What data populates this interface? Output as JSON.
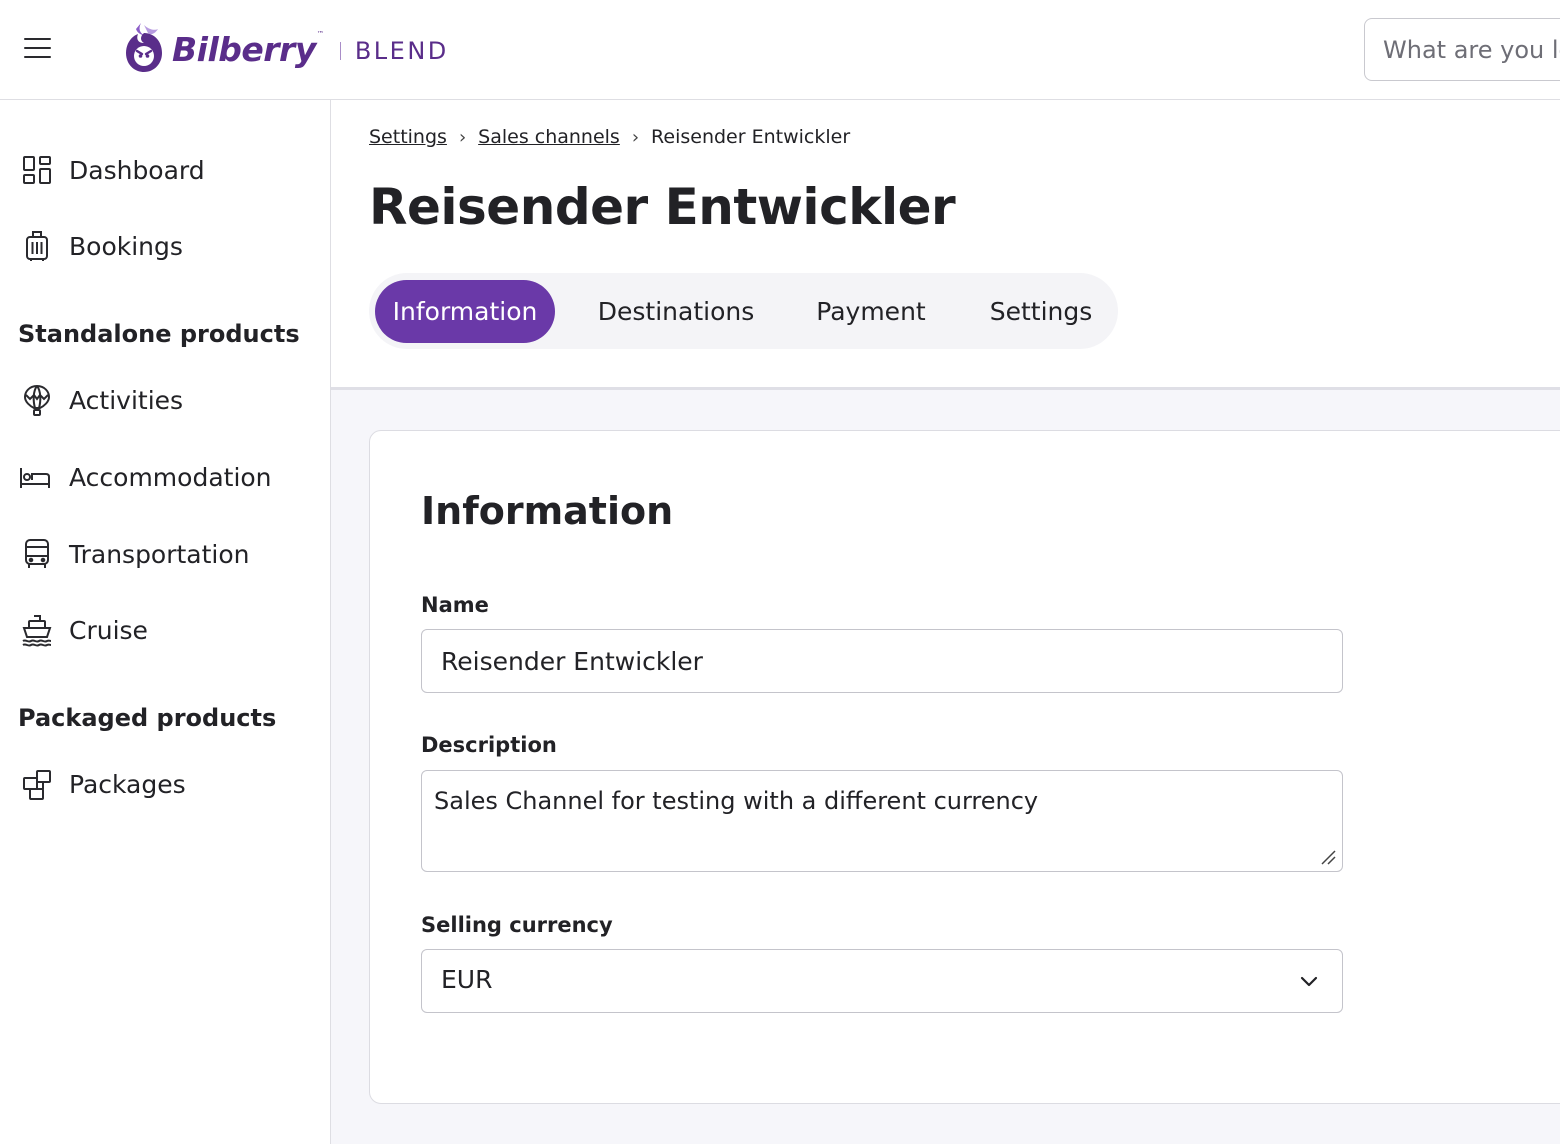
{
  "header": {
    "logo_text": "Bilberry",
    "logo_tm": "™",
    "logo_sub": "BLEND",
    "search_placeholder": "What are you looking for?"
  },
  "sidebar": {
    "items_top": [
      {
        "label": "Dashboard",
        "icon": "dashboard-icon"
      },
      {
        "label": "Bookings",
        "icon": "luggage-icon"
      }
    ],
    "standalone_heading": "Standalone products",
    "standalone_items": [
      {
        "label": "Activities",
        "icon": "hot-air-balloon-icon"
      },
      {
        "label": "Accommodation",
        "icon": "bed-icon"
      },
      {
        "label": "Transportation",
        "icon": "bus-icon"
      },
      {
        "label": "Cruise",
        "icon": "ship-icon"
      }
    ],
    "packaged_heading": "Packaged products",
    "packaged_items": [
      {
        "label": "Packages",
        "icon": "packages-icon"
      }
    ]
  },
  "breadcrumb": {
    "items": [
      "Settings",
      "Sales channels"
    ],
    "current": "Reisender Entwickler",
    "separator": "›"
  },
  "page": {
    "title": "Reisender Entwickler"
  },
  "tabs": [
    {
      "label": "Information",
      "active": true
    },
    {
      "label": "Destinations",
      "active": false
    },
    {
      "label": "Payment",
      "active": false
    },
    {
      "label": "Settings",
      "active": false
    }
  ],
  "form": {
    "title": "Information",
    "name_label": "Name",
    "name_value": "Reisender Entwickler",
    "description_label": "Description",
    "description_value": "Sales Channel for testing with a different currency",
    "currency_label": "Selling currency",
    "currency_value": "EUR"
  },
  "colors": {
    "accent": "#6a39a8",
    "brand": "#5a2d8a"
  }
}
